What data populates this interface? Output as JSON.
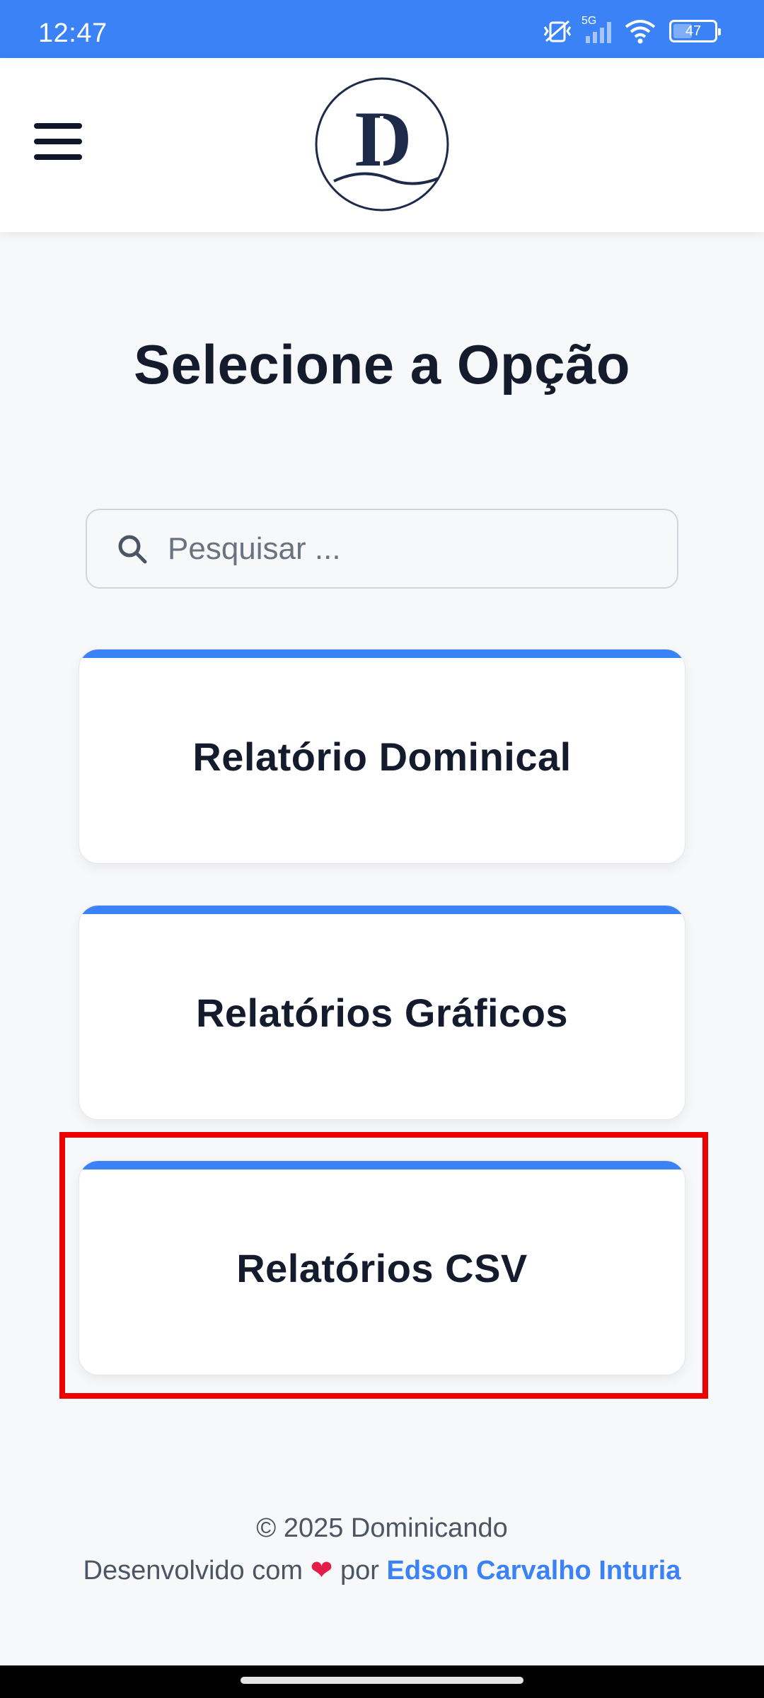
{
  "status_bar": {
    "time": "12:47",
    "network": "5G",
    "battery": "47",
    "battery_level": 0.47,
    "icons": [
      "vibrate-icon",
      "signal-icon",
      "wifi-icon",
      "battery-icon"
    ]
  },
  "header": {
    "menu_icon": "hamburger-menu-icon",
    "logo_letters": "D"
  },
  "main": {
    "title": "Selecione a Opção",
    "search": {
      "placeholder": "Pesquisar ...",
      "value": ""
    },
    "cards": [
      {
        "label": "Relatório Dominical"
      },
      {
        "label": "Relatórios Gráficos"
      },
      {
        "label": "Relatórios CSV"
      }
    ]
  },
  "footer": {
    "copyright": "© 2025 Dominicando",
    "developed_prefix": "Desenvolvido com",
    "heart": "❤",
    "developed_by": "por",
    "author": "Edson Carvalho Inturia"
  },
  "colors": {
    "accent": "#3b82f6",
    "title": "#141b2d",
    "highlight": "#ee0000"
  }
}
